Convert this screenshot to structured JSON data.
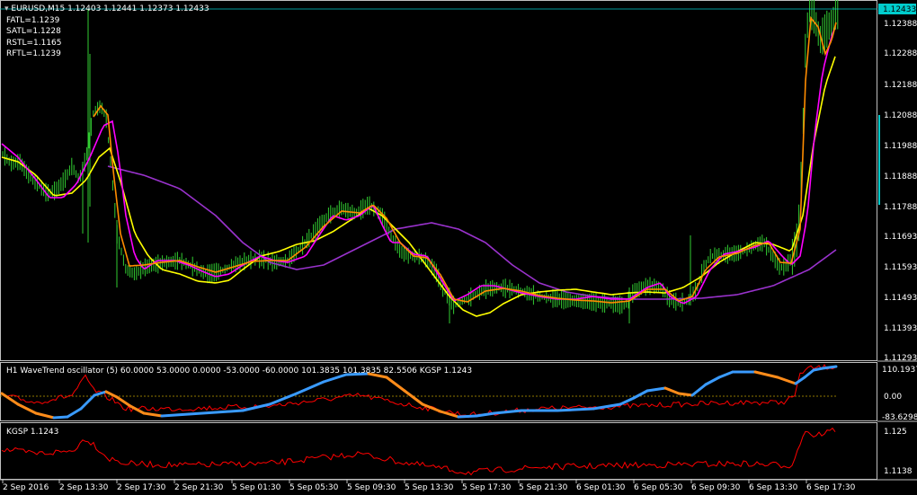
{
  "main": {
    "symbol_header": "EURUSD,M15  1.12403 1.12441 1.12373 1.12433",
    "indicators": [
      "FATL=1.1239",
      "SATL=1.1228",
      "RSTL=1.1165",
      "RFTL=1.1239"
    ],
    "price_labels": [
      "1.12388",
      "1.12288",
      "1.12188",
      "1.12088",
      "1.11988",
      "1.11888",
      "1.11788",
      "1.11693",
      "1.11593",
      "1.11493",
      "1.11393",
      "1.11293"
    ],
    "current_price": "1.12433"
  },
  "panel1": {
    "header": "H1 WaveTrend oscillator (5) 60.0000 53.0000 0.0000 -53.0000 -60.0000 101.3835 101.3835 82.5506  KGSP 1.1243",
    "axis_labels": [
      "110.1937",
      "0.00",
      "-83.6298"
    ]
  },
  "panel2": {
    "header": "KGSP 1.1243",
    "axis_labels": [
      "1.125",
      "1.1138"
    ]
  },
  "time_labels": [
    "2 Sep 2016",
    "2 Sep 13:30",
    "2 Sep 17:30",
    "2 Sep 21:30",
    "5 Sep 01:30",
    "5 Sep 05:30",
    "5 Sep 09:30",
    "5 Sep 13:30",
    "5 Sep 17:30",
    "5 Sep 21:30",
    "6 Sep 01:30",
    "6 Sep 05:30",
    "6 Sep 09:30",
    "6 Sep 13:30",
    "6 Sep 17:30"
  ],
  "colors": {
    "candles": "#32cd32",
    "fatl": "#ffff00",
    "satl": "#ff00ff",
    "rstl": "#9932cc",
    "rftl": "#ff8c00",
    "wave_up": "#3a9bff",
    "wave_down": "#ff8c1a",
    "kgsp": "#ff0000",
    "frame": "#c0c0c0",
    "current_price_bg": "#00cccc"
  }
}
